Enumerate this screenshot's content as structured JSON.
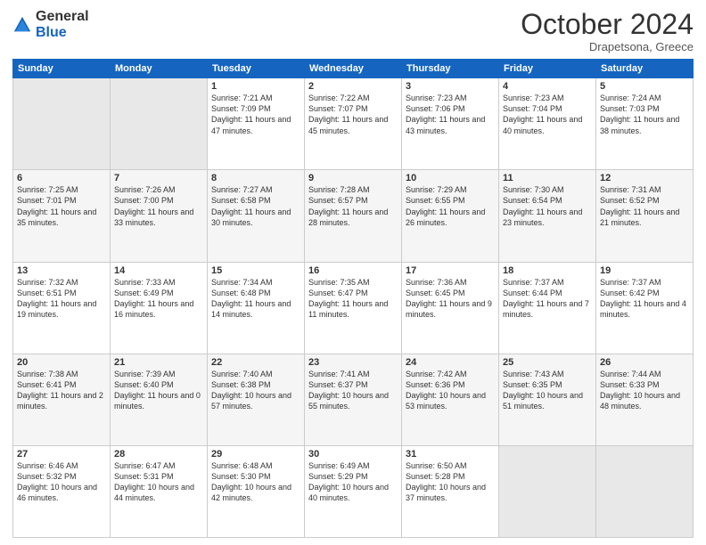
{
  "logo": {
    "general": "General",
    "blue": "Blue"
  },
  "header": {
    "month": "October 2024",
    "location": "Drapetsona, Greece"
  },
  "weekdays": [
    "Sunday",
    "Monday",
    "Tuesday",
    "Wednesday",
    "Thursday",
    "Friday",
    "Saturday"
  ],
  "weeks": [
    [
      {
        "day": "",
        "info": ""
      },
      {
        "day": "",
        "info": ""
      },
      {
        "day": "1",
        "info": "Sunrise: 7:21 AM\nSunset: 7:09 PM\nDaylight: 11 hours and 47 minutes."
      },
      {
        "day": "2",
        "info": "Sunrise: 7:22 AM\nSunset: 7:07 PM\nDaylight: 11 hours and 45 minutes."
      },
      {
        "day": "3",
        "info": "Sunrise: 7:23 AM\nSunset: 7:06 PM\nDaylight: 11 hours and 43 minutes."
      },
      {
        "day": "4",
        "info": "Sunrise: 7:23 AM\nSunset: 7:04 PM\nDaylight: 11 hours and 40 minutes."
      },
      {
        "day": "5",
        "info": "Sunrise: 7:24 AM\nSunset: 7:03 PM\nDaylight: 11 hours and 38 minutes."
      }
    ],
    [
      {
        "day": "6",
        "info": "Sunrise: 7:25 AM\nSunset: 7:01 PM\nDaylight: 11 hours and 35 minutes."
      },
      {
        "day": "7",
        "info": "Sunrise: 7:26 AM\nSunset: 7:00 PM\nDaylight: 11 hours and 33 minutes."
      },
      {
        "day": "8",
        "info": "Sunrise: 7:27 AM\nSunset: 6:58 PM\nDaylight: 11 hours and 30 minutes."
      },
      {
        "day": "9",
        "info": "Sunrise: 7:28 AM\nSunset: 6:57 PM\nDaylight: 11 hours and 28 minutes."
      },
      {
        "day": "10",
        "info": "Sunrise: 7:29 AM\nSunset: 6:55 PM\nDaylight: 11 hours and 26 minutes."
      },
      {
        "day": "11",
        "info": "Sunrise: 7:30 AM\nSunset: 6:54 PM\nDaylight: 11 hours and 23 minutes."
      },
      {
        "day": "12",
        "info": "Sunrise: 7:31 AM\nSunset: 6:52 PM\nDaylight: 11 hours and 21 minutes."
      }
    ],
    [
      {
        "day": "13",
        "info": "Sunrise: 7:32 AM\nSunset: 6:51 PM\nDaylight: 11 hours and 19 minutes."
      },
      {
        "day": "14",
        "info": "Sunrise: 7:33 AM\nSunset: 6:49 PM\nDaylight: 11 hours and 16 minutes."
      },
      {
        "day": "15",
        "info": "Sunrise: 7:34 AM\nSunset: 6:48 PM\nDaylight: 11 hours and 14 minutes."
      },
      {
        "day": "16",
        "info": "Sunrise: 7:35 AM\nSunset: 6:47 PM\nDaylight: 11 hours and 11 minutes."
      },
      {
        "day": "17",
        "info": "Sunrise: 7:36 AM\nSunset: 6:45 PM\nDaylight: 11 hours and 9 minutes."
      },
      {
        "day": "18",
        "info": "Sunrise: 7:37 AM\nSunset: 6:44 PM\nDaylight: 11 hours and 7 minutes."
      },
      {
        "day": "19",
        "info": "Sunrise: 7:37 AM\nSunset: 6:42 PM\nDaylight: 11 hours and 4 minutes."
      }
    ],
    [
      {
        "day": "20",
        "info": "Sunrise: 7:38 AM\nSunset: 6:41 PM\nDaylight: 11 hours and 2 minutes."
      },
      {
        "day": "21",
        "info": "Sunrise: 7:39 AM\nSunset: 6:40 PM\nDaylight: 11 hours and 0 minutes."
      },
      {
        "day": "22",
        "info": "Sunrise: 7:40 AM\nSunset: 6:38 PM\nDaylight: 10 hours and 57 minutes."
      },
      {
        "day": "23",
        "info": "Sunrise: 7:41 AM\nSunset: 6:37 PM\nDaylight: 10 hours and 55 minutes."
      },
      {
        "day": "24",
        "info": "Sunrise: 7:42 AM\nSunset: 6:36 PM\nDaylight: 10 hours and 53 minutes."
      },
      {
        "day": "25",
        "info": "Sunrise: 7:43 AM\nSunset: 6:35 PM\nDaylight: 10 hours and 51 minutes."
      },
      {
        "day": "26",
        "info": "Sunrise: 7:44 AM\nSunset: 6:33 PM\nDaylight: 10 hours and 48 minutes."
      }
    ],
    [
      {
        "day": "27",
        "info": "Sunrise: 6:46 AM\nSunset: 5:32 PM\nDaylight: 10 hours and 46 minutes."
      },
      {
        "day": "28",
        "info": "Sunrise: 6:47 AM\nSunset: 5:31 PM\nDaylight: 10 hours and 44 minutes."
      },
      {
        "day": "29",
        "info": "Sunrise: 6:48 AM\nSunset: 5:30 PM\nDaylight: 10 hours and 42 minutes."
      },
      {
        "day": "30",
        "info": "Sunrise: 6:49 AM\nSunset: 5:29 PM\nDaylight: 10 hours and 40 minutes."
      },
      {
        "day": "31",
        "info": "Sunrise: 6:50 AM\nSunset: 5:28 PM\nDaylight: 10 hours and 37 minutes."
      },
      {
        "day": "",
        "info": ""
      },
      {
        "day": "",
        "info": ""
      }
    ]
  ]
}
